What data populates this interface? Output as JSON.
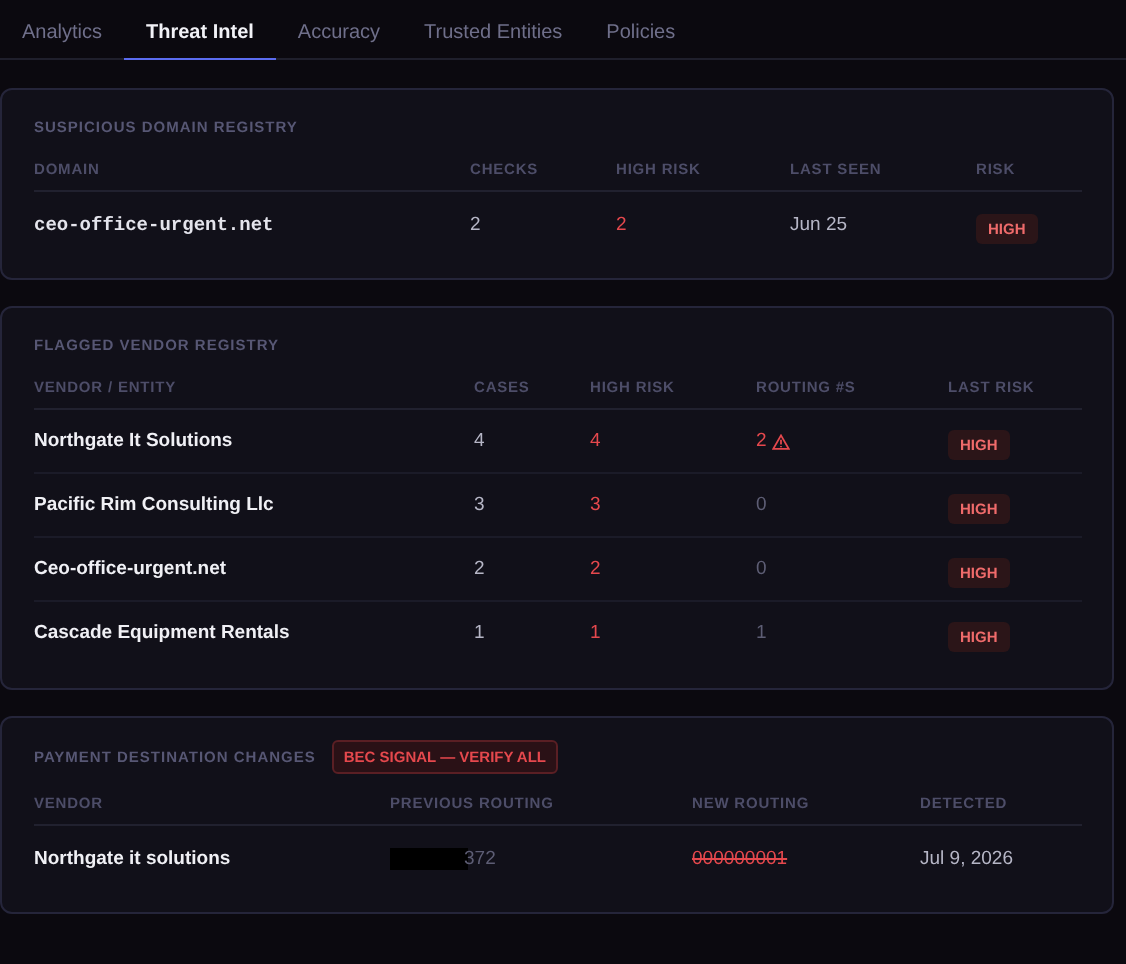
{
  "tabs": [
    {
      "label": "Analytics",
      "selected": false
    },
    {
      "label": "Threat Intel",
      "selected": true
    },
    {
      "label": "Accuracy",
      "selected": false
    },
    {
      "label": "Trusted Entities",
      "selected": false
    },
    {
      "label": "Policies",
      "selected": false
    }
  ],
  "domain_registry": {
    "title": "SUSPICIOUS DOMAIN REGISTRY",
    "columns": [
      "DOMAIN",
      "CHECKS",
      "HIGH RISK",
      "LAST SEEN",
      "RISK"
    ],
    "rows": [
      {
        "domain": "ceo-office-urgent.net",
        "checks": "2",
        "high_risk": "2",
        "last_seen": "Jun 25",
        "risk": "HIGH"
      }
    ]
  },
  "vendor_registry": {
    "title": "FLAGGED VENDOR REGISTRY",
    "columns": [
      "VENDOR / ENTITY",
      "CASES",
      "HIGH RISK",
      "ROUTING #S",
      "LAST RISK"
    ],
    "rows": [
      {
        "vendor": "Northgate It Solutions",
        "cases": "4",
        "high_risk": "4",
        "routing": "2",
        "flagged": true,
        "last_risk": "HIGH"
      },
      {
        "vendor": "Pacific Rim Consulting Llc",
        "cases": "3",
        "high_risk": "3",
        "routing": "0",
        "flagged": false,
        "last_risk": "HIGH"
      },
      {
        "vendor": "Ceo-office-urgent.net",
        "cases": "2",
        "high_risk": "2",
        "routing": "0",
        "flagged": false,
        "last_risk": "HIGH"
      },
      {
        "vendor": "Cascade Equipment Rentals",
        "cases": "1",
        "high_risk": "1",
        "routing": "1",
        "flagged": false,
        "last_risk": "HIGH"
      }
    ]
  },
  "payment_changes": {
    "title": "PAYMENT DESTINATION CHANGES",
    "badge": "BEC SIGNAL — VERIFY ALL",
    "columns": [
      "VENDOR",
      "PREVIOUS ROUTING",
      "NEW ROUTING",
      "DETECTED"
    ],
    "rows": [
      {
        "vendor": "Northgate it solutions",
        "previous_routing": "372",
        "redacted": true,
        "new_routing": "000000001",
        "struck": true,
        "detected": "Jul 9, 2026"
      }
    ]
  }
}
